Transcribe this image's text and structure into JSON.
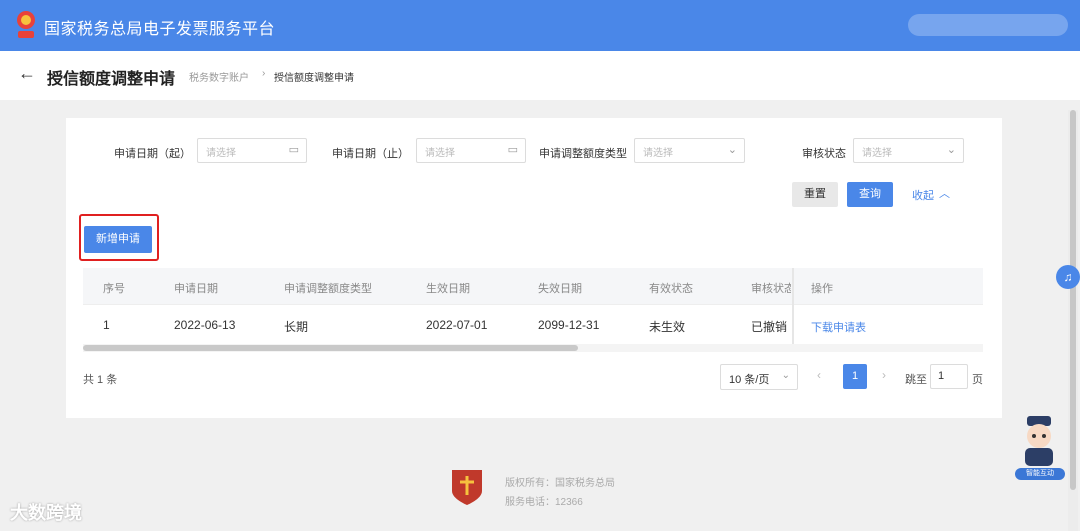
{
  "header": {
    "app_title": "国家税务总局电子发票服务平台",
    "accent_color": "#4a87e8"
  },
  "page": {
    "back_icon": "arrow-left-icon",
    "title": "授信额度调整申请",
    "breadcrumb_parent": "税务数字账户",
    "breadcrumb_separator": "›",
    "breadcrumb_current": "授信额度调整申请"
  },
  "filters": {
    "start_date_label": "申请日期（起）",
    "start_date_placeholder": "请选择",
    "end_date_label": "申请日期（止）",
    "end_date_placeholder": "请选择",
    "adjust_type_label": "申请调整额度类型",
    "adjust_type_placeholder": "请选择",
    "audit_status_label": "审核状态",
    "audit_status_placeholder": "请选择",
    "calendar_icon": "calendar-icon",
    "dropdown_icon": "chevron-down-icon"
  },
  "actions": {
    "reset_label": "重置",
    "query_label": "查询",
    "collapse_label": "收起",
    "collapse_icon": "chevron-up-icon",
    "new_label": "新增申请",
    "highlight_color": "#e02020"
  },
  "table": {
    "columns": [
      "序号",
      "申请日期",
      "申请调整额度类型",
      "生效日期",
      "失效日期",
      "有效状态",
      "审核状态",
      "操作"
    ],
    "rows": [
      {
        "index": "1",
        "apply_date": "2022-06-13",
        "type": "长期",
        "effective_date": "2022-07-01",
        "expire_date": "2099-12-31",
        "valid_status": "未生效",
        "audit_status": "已撤销",
        "action": "下载申请表"
      }
    ],
    "horizontal_scroll_fraction": 0.55
  },
  "pagination": {
    "total_text": "共 1 条",
    "page_size": "10 条/页",
    "current_page": "1",
    "goto_prefix": "跳至",
    "goto_value": "1",
    "goto_suffix": "页"
  },
  "footer": {
    "copyright": "版权所有：国家税务总局",
    "phone": "服务电话：12366"
  },
  "widgets": {
    "headset_icon": "headset-icon",
    "assistant_label": "智能互动"
  },
  "watermark": "大数跨境"
}
